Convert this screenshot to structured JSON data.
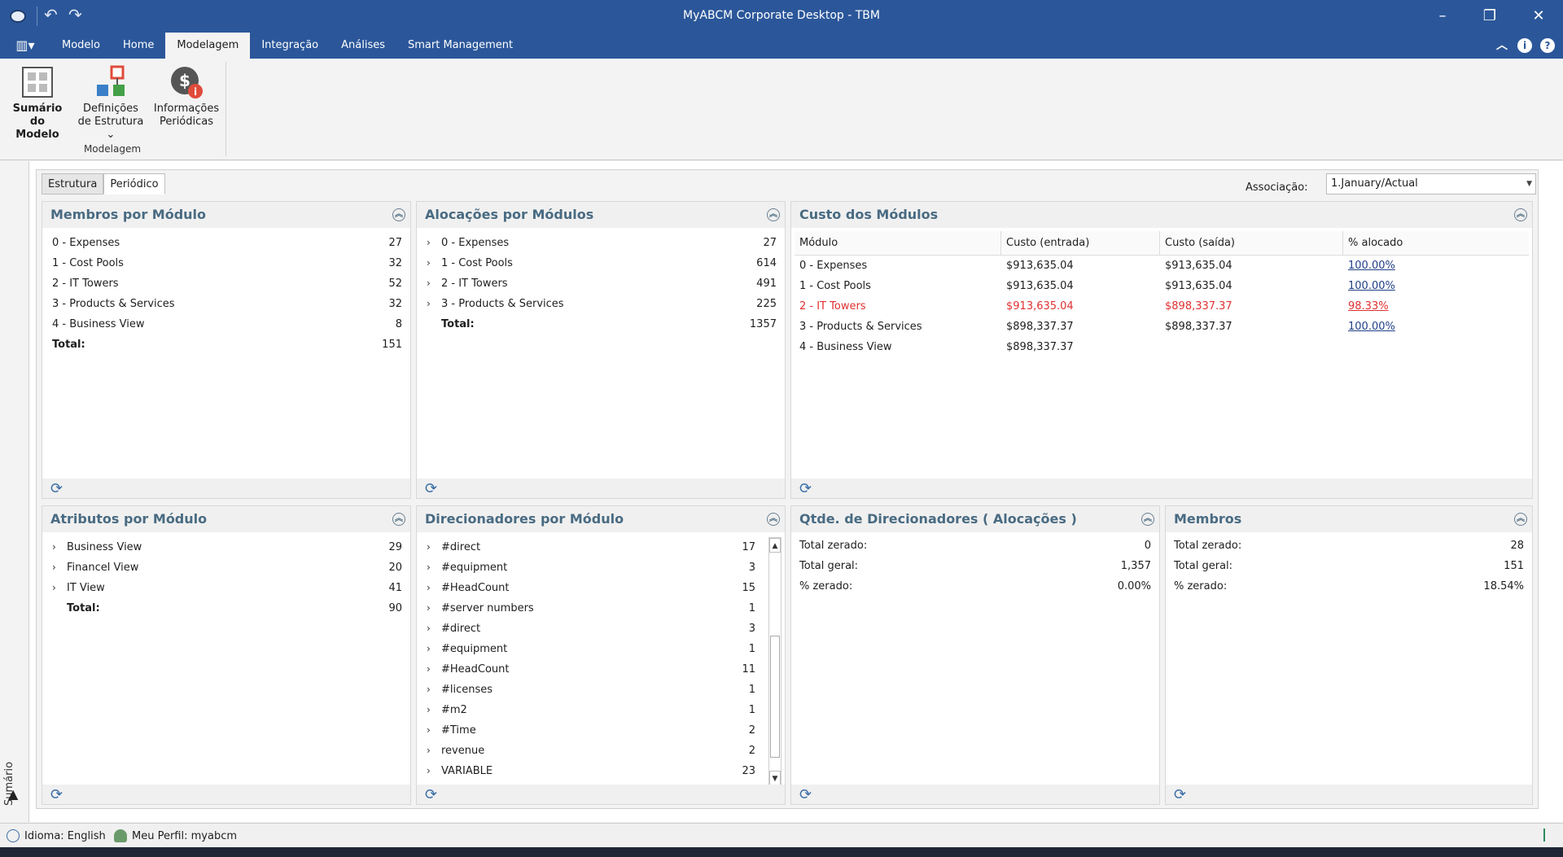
{
  "window": {
    "title": "MyABCM Corporate Desktop - TBM"
  },
  "menu": {
    "tabs": [
      "Modelo",
      "Home",
      "Modelagem",
      "Integração",
      "Análises",
      "Smart Management"
    ],
    "active": "Modelagem"
  },
  "ribbon": {
    "buttons": [
      {
        "line1": "Sumário",
        "line2": "do Modelo",
        "icon": "model-summary-icon"
      },
      {
        "line1": "Definições",
        "line2": "de Estrutura",
        "icon": "structure-definitions-icon"
      },
      {
        "line1": "Informações",
        "line2": "Periódicas",
        "icon": "periodic-info-icon"
      }
    ],
    "group_label": "Modelagem"
  },
  "doc_tabs": [
    "Estrutura",
    "Periódico"
  ],
  "association": {
    "label": "Associação:",
    "value": "1.January/Actual"
  },
  "membros_por_modulo": {
    "title": "Membros por Módulo",
    "rows": [
      {
        "label": "0 - Expenses",
        "value": "27"
      },
      {
        "label": "1 - Cost Pools",
        "value": "32"
      },
      {
        "label": "2 - IT Towers",
        "value": "52"
      },
      {
        "label": "3 - Products & Services",
        "value": "32"
      },
      {
        "label": "4 - Business View",
        "value": "8"
      }
    ],
    "total_label": "Total:",
    "total": "151"
  },
  "alocacoes_por_modulos": {
    "title": "Alocações por Módulos",
    "rows": [
      {
        "label": "0 - Expenses",
        "value": "27"
      },
      {
        "label": "1 - Cost Pools",
        "value": "614"
      },
      {
        "label": "2 - IT Towers",
        "value": "491"
      },
      {
        "label": "3 - Products & Services",
        "value": "225"
      }
    ],
    "total_label": "Total:",
    "total": "1357"
  },
  "custo_dos_modulos": {
    "title": "Custo dos Módulos",
    "columns": [
      "Módulo",
      "Custo (entrada)",
      "Custo (saída)",
      "% alocado"
    ],
    "rows": [
      {
        "modulo": "0 - Expenses",
        "entrada": "$913,635.04",
        "saida": "$913,635.04",
        "alocado": "100.00%",
        "highlight": false
      },
      {
        "modulo": "1 - Cost Pools",
        "entrada": "$913,635.04",
        "saida": "$913,635.04",
        "alocado": "100.00%",
        "highlight": false
      },
      {
        "modulo": "2 - IT Towers",
        "entrada": "$913,635.04",
        "saida": "$898,337.37",
        "alocado": "98.33%",
        "highlight": true
      },
      {
        "modulo": "3 - Products & Services",
        "entrada": "$898,337.37",
        "saida": "$898,337.37",
        "alocado": "100.00%",
        "highlight": false
      },
      {
        "modulo": "4 - Business View",
        "entrada": "$898,337.37",
        "saida": "",
        "alocado": "",
        "highlight": false
      }
    ]
  },
  "atributos_por_modulo": {
    "title": "Atributos por Módulo",
    "rows": [
      {
        "label": "Business View",
        "value": "29"
      },
      {
        "label": "Financel View",
        "value": "20"
      },
      {
        "label": "IT View",
        "value": "41"
      }
    ],
    "total_label": "Total:",
    "total": "90"
  },
  "direcionadores_por_modulo": {
    "title": "Direcionadores por Módulo",
    "rows": [
      {
        "label": "#direct",
        "value": "17"
      },
      {
        "label": "#equipment",
        "value": "3"
      },
      {
        "label": "#HeadCount",
        "value": "15"
      },
      {
        "label": "#server numbers",
        "value": "1"
      },
      {
        "label": "#direct",
        "value": "3"
      },
      {
        "label": "#equipment",
        "value": "1"
      },
      {
        "label": "#HeadCount",
        "value": "11"
      },
      {
        "label": "#licenses",
        "value": "1"
      },
      {
        "label": "#m2",
        "value": "1"
      },
      {
        "label": "#Time",
        "value": "2"
      },
      {
        "label": "revenue",
        "value": "2"
      },
      {
        "label": "VARIABLE",
        "value": "23"
      }
    ]
  },
  "qtde_direcionadores": {
    "title": "Qtde. de Direcionadores ( Alocações )",
    "rows": [
      {
        "label": "Total zerado:",
        "value": "0"
      },
      {
        "label": "Total geral:",
        "value": "1,357"
      },
      {
        "label": "% zerado:",
        "value": "0.00%"
      }
    ]
  },
  "membros": {
    "title": "Membros",
    "rows": [
      {
        "label": "Total zerado:",
        "value": "28"
      },
      {
        "label": "Total geral:",
        "value": "151"
      },
      {
        "label": "% zerado:",
        "value": "18.54%"
      }
    ]
  },
  "sidebar": {
    "label": "Sumário"
  },
  "status": {
    "language": "Idioma: English",
    "profile": "Meu Perfil: myabcm"
  },
  "colors": {
    "titlebar": "#2b579a",
    "panel_title": "#496b82",
    "alert": "#e03030"
  }
}
